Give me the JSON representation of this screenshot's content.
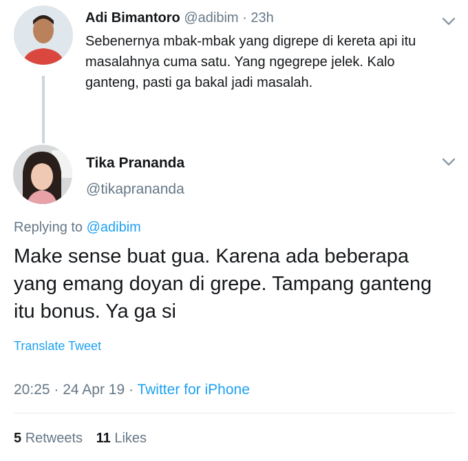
{
  "parent_tweet": {
    "name": "Adi Bimantoro",
    "handle": "@adibim",
    "separator": "·",
    "time": "23h",
    "text": "Sebenernya mbak-mbak yang digrepe di kereta api itu masalahnya cuma satu. Yang ngegrepe jelek. Kalo ganteng, pasti ga bakal jadi masalah."
  },
  "main_tweet": {
    "name": "Tika Prananda",
    "handle": "@tikaprananda",
    "replying_prefix": "Replying to",
    "replying_handle": "@adibim",
    "text": "Make sense buat gua. Karena ada beberapa yang emang doyan di grepe. Tampang ganteng itu bonus. Ya ga si",
    "translate_label": "Translate Tweet",
    "time": "20:25",
    "sep1": "·",
    "date": "24 Apr 19",
    "sep2": "·",
    "source": "Twitter for iPhone",
    "retweets_count": "5",
    "retweets_label": "Retweets",
    "likes_count": "11",
    "likes_label": "Likes"
  },
  "icons": {
    "parent_menu": "chevron-down-icon",
    "main_menu": "chevron-down-icon"
  },
  "colors": {
    "link": "#1da1f2",
    "muted": "#657786",
    "text": "#14171a",
    "line": "#ccd6dd"
  }
}
